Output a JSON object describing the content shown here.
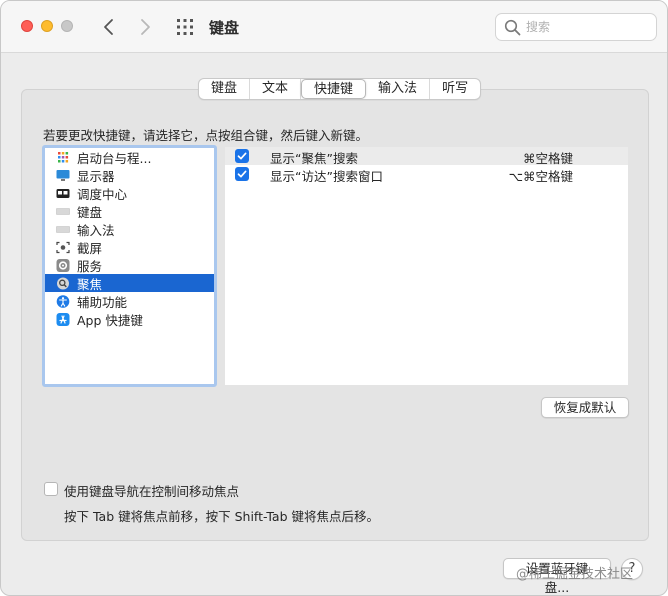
{
  "window": {
    "title": "键盘"
  },
  "search": {
    "placeholder": "搜索",
    "value": ""
  },
  "tabs": [
    {
      "label": "键盘",
      "active": false
    },
    {
      "label": "文本",
      "active": false
    },
    {
      "label": "快捷键",
      "active": true
    },
    {
      "label": "输入法",
      "active": false
    },
    {
      "label": "听写",
      "active": false
    }
  ],
  "instruction": "若要更改快捷键，请选择它，点按组合键，然后键入新键。",
  "categories": [
    {
      "label": "启动台与程...",
      "icon": "launchpad-icon",
      "selected": false
    },
    {
      "label": "显示器",
      "icon": "display-icon",
      "selected": false
    },
    {
      "label": "调度中心",
      "icon": "mission-control-icon",
      "selected": false
    },
    {
      "label": "键盘",
      "icon": "keyboard-icon",
      "selected": false
    },
    {
      "label": "输入法",
      "icon": "input-source-icon",
      "selected": false
    },
    {
      "label": "截屏",
      "icon": "screenshot-icon",
      "selected": false
    },
    {
      "label": "服务",
      "icon": "gear-icon",
      "selected": false
    },
    {
      "label": "聚焦",
      "icon": "spotlight-icon",
      "selected": true
    },
    {
      "label": "辅助功能",
      "icon": "accessibility-icon",
      "selected": false
    },
    {
      "label": "App 快捷键",
      "icon": "app-store-icon",
      "selected": false
    }
  ],
  "shortcuts": [
    {
      "checked": true,
      "label": "显示“聚焦”搜索",
      "key": "⌘空格键"
    },
    {
      "checked": true,
      "label": "显示“访达”搜索窗口",
      "key": "⌥⌘空格键"
    }
  ],
  "buttons": {
    "restore_defaults": "恢复成默认",
    "bluetooth_keyboard": "设置蓝牙键盘...",
    "help": "?"
  },
  "keyboard_navigation": {
    "checked": false,
    "label": "使用键盘导航在控制间移动焦点",
    "hint": "按下 Tab 键将焦点前移，按下 Shift-Tab 键将焦点后移。"
  },
  "watermark": "@稀土掘金技术社区",
  "colors": {
    "selection": "#1a66d1",
    "checkbox": "#1a73e8",
    "focus_ring": "#a9c7ee"
  }
}
